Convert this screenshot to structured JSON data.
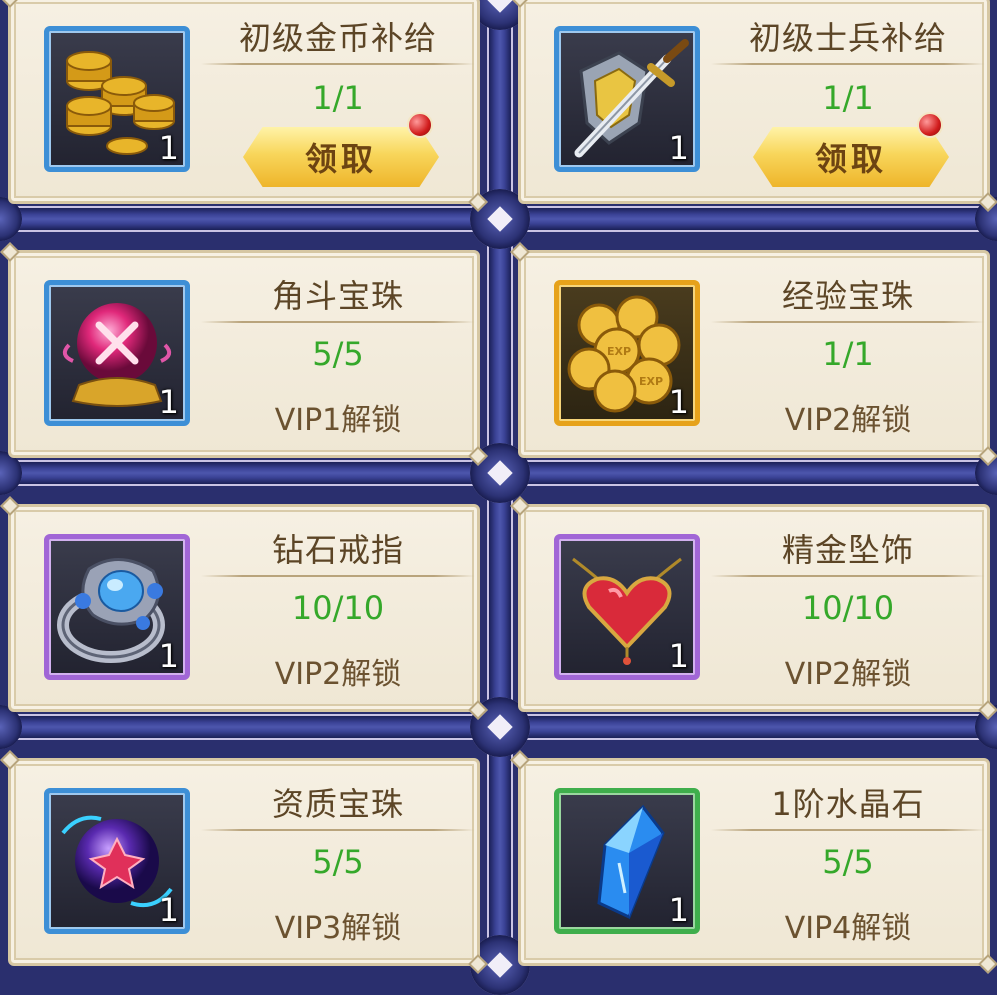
{
  "cards": [
    {
      "title": "初级金币补给",
      "count": "1/1",
      "qty": "1",
      "action": "领取",
      "icon": "gold-coins-icon",
      "rarity": "blue"
    },
    {
      "title": "初级士兵补给",
      "count": "1/1",
      "qty": "1",
      "action": "领取",
      "icon": "sword-shield-icon",
      "rarity": "blue"
    },
    {
      "title": "角斗宝珠",
      "count": "5/5",
      "qty": "1",
      "lock": "VIP1解锁",
      "icon": "arena-orb-icon",
      "rarity": "blue"
    },
    {
      "title": "经验宝珠",
      "count": "1/1",
      "qty": "1",
      "lock": "VIP2解锁",
      "icon": "exp-coins-icon",
      "rarity": "gold"
    },
    {
      "title": "钻石戒指",
      "count": "10/10",
      "qty": "1",
      "lock": "VIP2解锁",
      "icon": "diamond-ring-icon",
      "rarity": "purple"
    },
    {
      "title": "精金坠饰",
      "count": "10/10",
      "qty": "1",
      "lock": "VIP2解锁",
      "icon": "heart-pendant-icon",
      "rarity": "purple"
    },
    {
      "title": "资质宝珠",
      "count": "5/5",
      "qty": "1",
      "lock": "VIP3解锁",
      "icon": "aptitude-orb-icon",
      "rarity": "blue"
    },
    {
      "title": "1阶水晶石",
      "count": "5/5",
      "qty": "1",
      "lock": "VIP4解锁",
      "icon": "crystal-icon",
      "rarity": "green"
    }
  ],
  "colors": {
    "count_green": "#35a82a",
    "frame_blue": "#3b4396",
    "card_bg": "#f3ecdc"
  }
}
